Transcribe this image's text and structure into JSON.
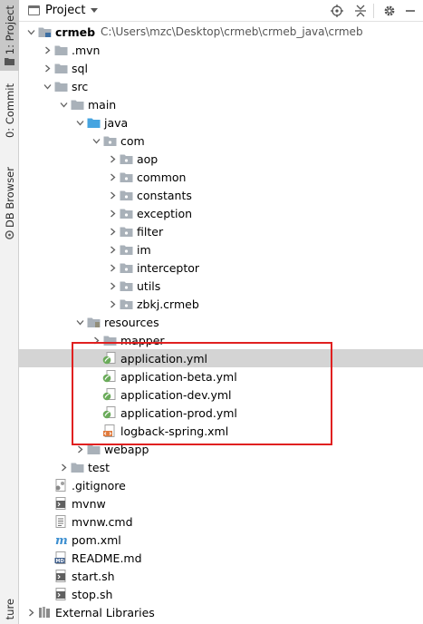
{
  "toolstrip": {
    "project_tab": "1: Project",
    "commit_tab": "0: Commit",
    "db_tab": "DB Browser",
    "structure_tab": "ture"
  },
  "header": {
    "title": "Project"
  },
  "tree": [
    {
      "label": "crmeb",
      "path": "C:\\Users\\mzc\\Desktop\\crmeb\\crmeb_java\\crmeb",
      "depth": 0,
      "arrow": "down",
      "icon": "module-folder-icon",
      "bold": true
    },
    {
      "label": ".mvn",
      "depth": 1,
      "arrow": "right",
      "icon": "folder-icon"
    },
    {
      "label": "sql",
      "depth": 1,
      "arrow": "right",
      "icon": "folder-icon"
    },
    {
      "label": "src",
      "depth": 1,
      "arrow": "down",
      "icon": "folder-icon"
    },
    {
      "label": "main",
      "depth": 2,
      "arrow": "down",
      "icon": "folder-icon"
    },
    {
      "label": "java",
      "depth": 3,
      "arrow": "down",
      "icon": "source-folder-icon"
    },
    {
      "label": "com",
      "depth": 4,
      "arrow": "down",
      "icon": "package-icon"
    },
    {
      "label": "aop",
      "depth": 5,
      "arrow": "right",
      "icon": "package-icon"
    },
    {
      "label": "common",
      "depth": 5,
      "arrow": "right",
      "icon": "package-icon"
    },
    {
      "label": "constants",
      "depth": 5,
      "arrow": "right",
      "icon": "package-icon"
    },
    {
      "label": "exception",
      "depth": 5,
      "arrow": "right",
      "icon": "package-icon"
    },
    {
      "label": "filter",
      "depth": 5,
      "arrow": "right",
      "icon": "package-icon"
    },
    {
      "label": "im",
      "depth": 5,
      "arrow": "right",
      "icon": "package-icon"
    },
    {
      "label": "interceptor",
      "depth": 5,
      "arrow": "right",
      "icon": "package-icon"
    },
    {
      "label": "utils",
      "depth": 5,
      "arrow": "right",
      "icon": "package-icon"
    },
    {
      "label": "zbkj.crmeb",
      "depth": 5,
      "arrow": "right",
      "icon": "package-icon"
    },
    {
      "label": "resources",
      "depth": 3,
      "arrow": "down",
      "icon": "resources-folder-icon"
    },
    {
      "label": "mapper",
      "depth": 4,
      "arrow": "right",
      "icon": "folder-icon"
    },
    {
      "label": "application.yml",
      "depth": 4,
      "arrow": "none",
      "icon": "spring-yml-icon",
      "selected": true
    },
    {
      "label": "application-beta.yml",
      "depth": 4,
      "arrow": "none",
      "icon": "spring-yml-icon"
    },
    {
      "label": "application-dev.yml",
      "depth": 4,
      "arrow": "none",
      "icon": "spring-yml-icon"
    },
    {
      "label": "application-prod.yml",
      "depth": 4,
      "arrow": "none",
      "icon": "spring-yml-icon"
    },
    {
      "label": "logback-spring.xml",
      "depth": 4,
      "arrow": "none",
      "icon": "xml-file-icon"
    },
    {
      "label": "webapp",
      "depth": 3,
      "arrow": "right",
      "icon": "folder-icon"
    },
    {
      "label": "test",
      "depth": 2,
      "arrow": "right",
      "icon": "folder-icon"
    },
    {
      "label": ".gitignore",
      "depth": 1,
      "arrow": "none",
      "icon": "gitignore-file-icon"
    },
    {
      "label": "mvnw",
      "depth": 1,
      "arrow": "none",
      "icon": "shell-file-icon"
    },
    {
      "label": "mvnw.cmd",
      "depth": 1,
      "arrow": "none",
      "icon": "text-file-icon"
    },
    {
      "label": "pom.xml",
      "depth": 1,
      "arrow": "none",
      "icon": "maven-icon"
    },
    {
      "label": "README.md",
      "depth": 1,
      "arrow": "none",
      "icon": "markdown-file-icon"
    },
    {
      "label": "start.sh",
      "depth": 1,
      "arrow": "none",
      "icon": "shell-file-icon"
    },
    {
      "label": "stop.sh",
      "depth": 1,
      "arrow": "none",
      "icon": "shell-file-icon"
    },
    {
      "label": "External Libraries",
      "depth": 0,
      "arrow": "right",
      "icon": "libraries-icon"
    }
  ],
  "colors": {
    "folder": "#a9b1b9",
    "source_folder": "#46a4e0",
    "spring": "#6aab5a",
    "highlight": "#e02020",
    "selection": "#d4d4d4"
  }
}
